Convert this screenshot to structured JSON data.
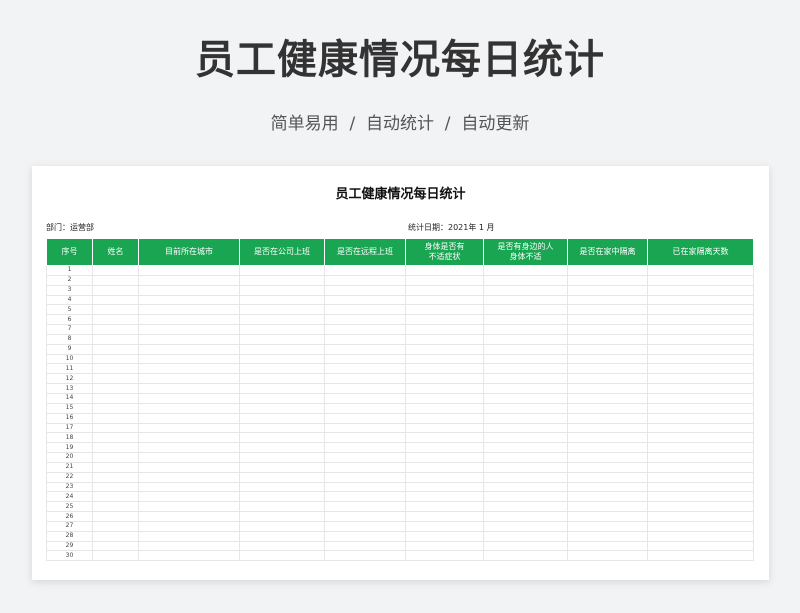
{
  "hero": {
    "title": "员工健康情况每日统计",
    "subtitle": "简单易用  /  自动统计  /  自动更新"
  },
  "sheet": {
    "title": "员工健康情况每日统计",
    "department": "部门：运营部",
    "stat_date": "统计日期：2021年 1 月",
    "columns": [
      "序号",
      "姓名",
      "目前所在城市",
      "是否在公司上班",
      "是否在远程上班",
      "身体是否有\n不适症状",
      "是否有身边的人\n身体不适",
      "是否在家中隔离",
      "已在家隔离天数"
    ],
    "row_numbers": [
      "1",
      "2",
      "3",
      "4",
      "5",
      "6",
      "7",
      "8",
      "9",
      "10",
      "11",
      "12",
      "13",
      "14",
      "15",
      "16",
      "17",
      "18",
      "19",
      "20",
      "21",
      "22",
      "23",
      "24",
      "25",
      "26",
      "27",
      "28",
      "29",
      "30"
    ]
  },
  "colors": {
    "header_green": "#1aa552",
    "page_background": "#f2f3f5"
  }
}
